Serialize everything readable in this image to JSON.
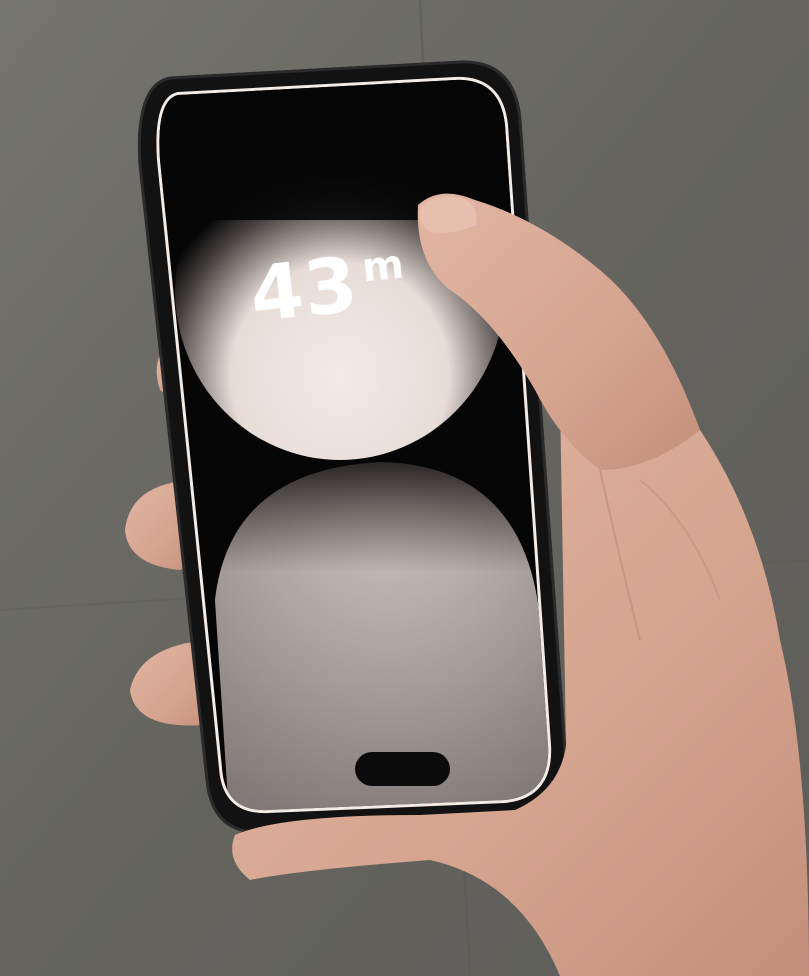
{
  "screen": {
    "distance_value": "43",
    "distance_unit": "m"
  },
  "colors": {
    "wall": "#6b6a66",
    "phone_frame": "#111111",
    "screen_black": "#050505",
    "screen_glow": "#efe6e0",
    "skin": "#d9a995",
    "text": "#ffffff"
  }
}
